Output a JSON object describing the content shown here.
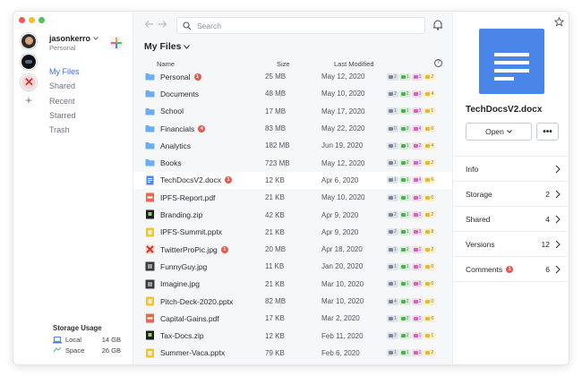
{
  "account": {
    "name": "jasonkerro",
    "plan": "Personal"
  },
  "nav": [
    "My Files",
    "Shared",
    "Recent",
    "Starred",
    "Trash"
  ],
  "storage": {
    "title": "Storage Usage",
    "items": [
      {
        "label": "Local",
        "value": "14 GB"
      },
      {
        "label": "Space",
        "value": "26 GB"
      }
    ]
  },
  "search": {
    "placeholder": "Search"
  },
  "folder_title": "My Files",
  "columns": {
    "name": "Name",
    "size": "Size",
    "modified": "Last Modified"
  },
  "files": [
    {
      "name": "Personal",
      "type": "folder",
      "badge": "1",
      "size": "25 MB",
      "date": "May 12, 2020",
      "stats": [
        "2",
        "1",
        "1",
        "2"
      ]
    },
    {
      "name": "Documents",
      "type": "folder",
      "badge": "",
      "size": "48 MB",
      "date": "May 10, 2020",
      "stats": [
        "2",
        "2",
        "1",
        "4"
      ]
    },
    {
      "name": "School",
      "type": "folder",
      "badge": "",
      "size": "17 MB",
      "date": "May 17, 2020",
      "stats": [
        "1",
        "1",
        "3",
        "1"
      ]
    },
    {
      "name": "Financials",
      "type": "folder",
      "badge": "4",
      "size": "83 MB",
      "date": "May 22, 2020",
      "stats": [
        "0",
        "0",
        "4",
        "0"
      ]
    },
    {
      "name": "Analytics",
      "type": "folder",
      "badge": "",
      "size": "182 MB",
      "date": "Jun 19, 2020",
      "stats": [
        "1",
        "1",
        "2",
        "4"
      ]
    },
    {
      "name": "Books",
      "type": "folder",
      "badge": "",
      "size": "723 MB",
      "date": "May 12, 2020",
      "stats": [
        "1",
        "2",
        "1",
        "2"
      ]
    },
    {
      "name": "TechDocsV2.docx",
      "type": "docx",
      "badge": "1",
      "size": "12 KB",
      "date": "Apr 6, 2020",
      "stats": [
        "1",
        "1",
        "4",
        "6"
      ],
      "selected": true
    },
    {
      "name": "IPFS-Report.pdf",
      "type": "pdf",
      "badge": "",
      "size": "21 KB",
      "date": "May 10, 2020",
      "stats": [
        "1",
        "1",
        "1",
        "0"
      ]
    },
    {
      "name": "Branding.zip",
      "type": "zip",
      "badge": "",
      "size": "42 KB",
      "date": "Apr 9, 2020",
      "stats": [
        "2",
        "1",
        "1",
        "2"
      ]
    },
    {
      "name": "IPFS-Summit.pptx",
      "type": "pptx",
      "badge": "",
      "size": "21 KB",
      "date": "Apr 9, 2020",
      "stats": [
        "2",
        "1",
        "3",
        "8"
      ]
    },
    {
      "name": "TwitterProPic.jpg",
      "type": "jpg-x",
      "badge": "1",
      "size": "20 MB",
      "date": "Apr 18, 2020",
      "stats": [
        "1",
        "2",
        "1",
        "2"
      ]
    },
    {
      "name": "FunnyGuy.jpg",
      "type": "jpg",
      "badge": "",
      "size": "11 KB",
      "date": "Jan 20, 2020",
      "stats": [
        "1",
        "1",
        "0",
        "0"
      ]
    },
    {
      "name": "Imagine.jpg",
      "type": "jpg",
      "badge": "",
      "size": "21 KB",
      "date": "Mar 10, 2020",
      "stats": [
        "1",
        "1",
        "0",
        "0"
      ]
    },
    {
      "name": "Pitch-Deck-2020.pptx",
      "type": "pptx",
      "badge": "",
      "size": "82 MB",
      "date": "Mar 10, 2020",
      "stats": [
        "4",
        "2",
        "2",
        "0"
      ]
    },
    {
      "name": "Capital-Gains.pdf",
      "type": "pdf",
      "badge": "",
      "size": "17 KB",
      "date": "Mar 2, 2020",
      "stats": [
        "1",
        "2",
        "1",
        "0"
      ]
    },
    {
      "name": "Tax-Docs.zip",
      "type": "zip",
      "badge": "",
      "size": "12 KB",
      "date": "Feb 11, 2020",
      "stats": [
        "2",
        "2",
        "1",
        "1"
      ]
    },
    {
      "name": "Summer-Vaca.pptx",
      "type": "pptx",
      "badge": "",
      "size": "79 KB",
      "date": "Feb 6, 2020",
      "stats": [
        "1",
        "1",
        "1",
        "2"
      ]
    }
  ],
  "details": {
    "title": "TechDocsV2.docx",
    "open_label": "Open",
    "more_label": "•••",
    "rows": [
      {
        "label": "Info",
        "count": "",
        "badge": ""
      },
      {
        "label": "Storage",
        "count": "2",
        "badge": ""
      },
      {
        "label": "Shared",
        "count": "4",
        "badge": ""
      },
      {
        "label": "Versions",
        "count": "12",
        "badge": ""
      },
      {
        "label": "Comments",
        "count": "6",
        "badge": "1"
      }
    ]
  },
  "colors": {
    "accent": "#3f6fde",
    "folder": "#6aaef0",
    "docx": "#4a86e8",
    "pdf": "#e8674f",
    "pptx": "#f4c430",
    "badge": "#e6594d"
  }
}
